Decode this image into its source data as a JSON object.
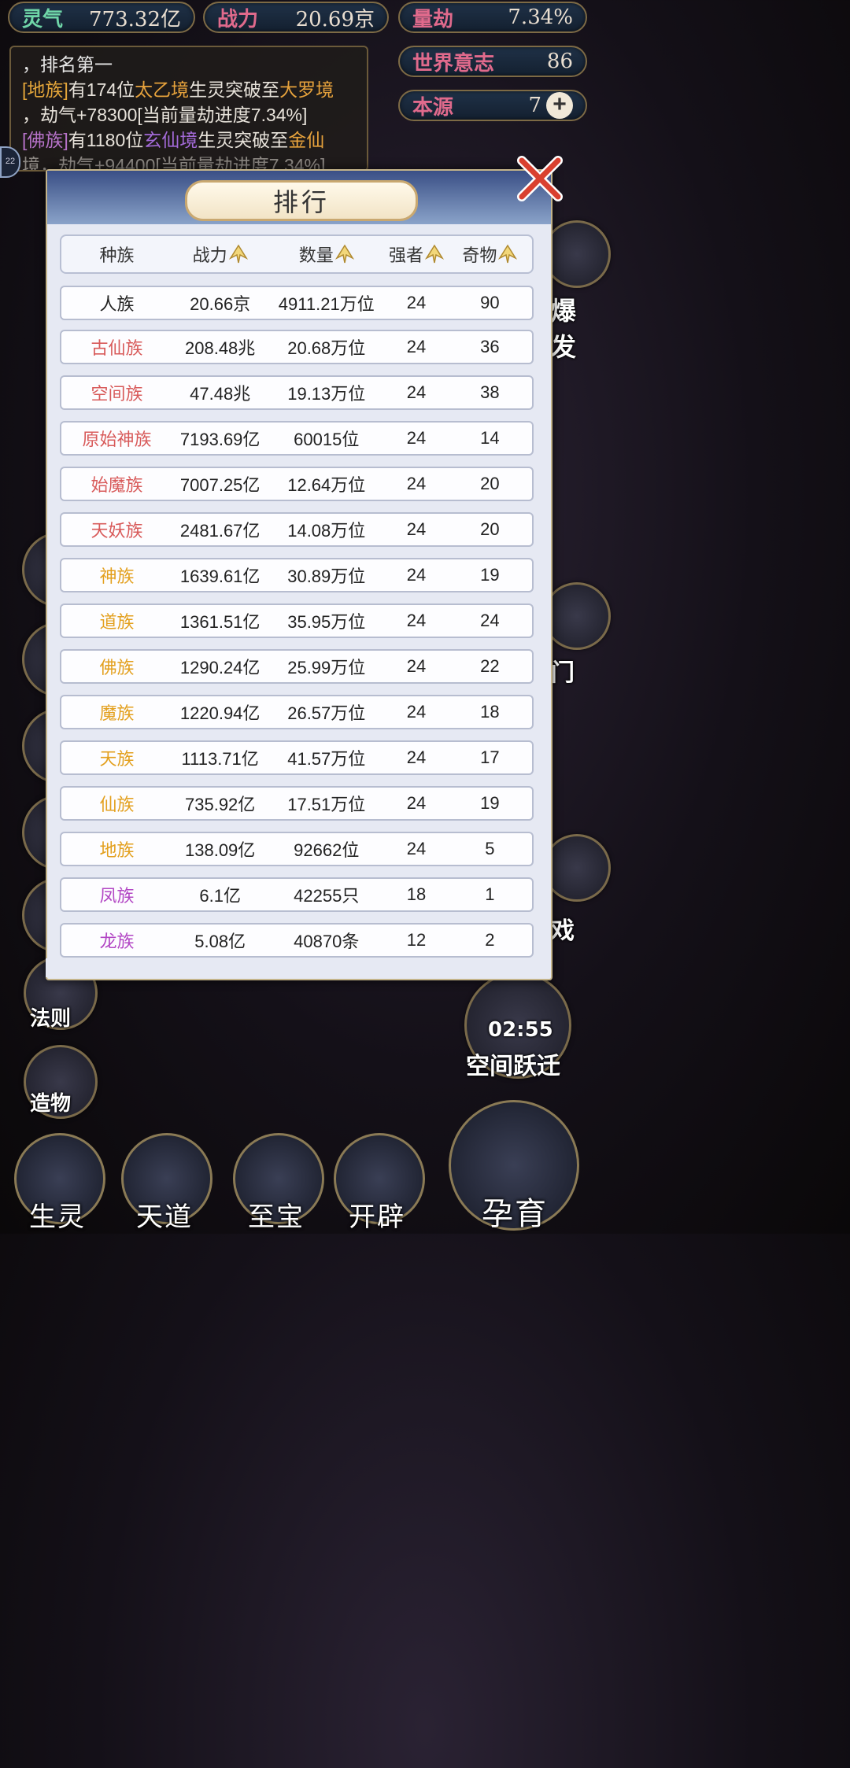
{
  "stats": {
    "lingqi": {
      "label": "灵气",
      "value": "773.32亿"
    },
    "zhanli": {
      "label": "战力",
      "value": "20.69京"
    },
    "liangjie": {
      "label": "量劫",
      "value": "7.34%"
    },
    "world_will": {
      "label": "世界意志",
      "value": "86"
    },
    "benyuan": {
      "label": "本源",
      "value": "7",
      "plus": "+"
    }
  },
  "log": {
    "line1": "，排名第一",
    "line2_a": "[地族]",
    "line2_b": "有174位",
    "line2_c": "太乙境",
    "line2_d": "生灵突破至",
    "line2_e": "大罗境",
    "line3": "，劫气+78300[当前量劫进度7.34%]",
    "line4_a": "[佛族]",
    "line4_b": "有1180位",
    "line4_c": "玄仙境",
    "line4_d": "生灵突破至",
    "line4_e": "金仙",
    "line5": "境，劫气+94400[当前量劫进度7.34%]",
    "side_badge": "22"
  },
  "modal": {
    "title": "排行",
    "headers": [
      "种族",
      "战力",
      "数量",
      "强者",
      "奇物"
    ],
    "rows": [
      {
        "race": "人族",
        "power": "20.66京",
        "count": "4911.21万位",
        "elite": "24",
        "treasure": "90",
        "color": "black"
      },
      {
        "race": "古仙族",
        "power": "208.48兆",
        "count": "20.68万位",
        "elite": "24",
        "treasure": "36",
        "color": "red"
      },
      {
        "race": "空间族",
        "power": "47.48兆",
        "count": "19.13万位",
        "elite": "24",
        "treasure": "38",
        "color": "red"
      },
      {
        "race": "原始神族",
        "power": "7193.69亿",
        "count": "60015位",
        "elite": "24",
        "treasure": "14",
        "color": "red"
      },
      {
        "race": "始魔族",
        "power": "7007.25亿",
        "count": "12.64万位",
        "elite": "24",
        "treasure": "20",
        "color": "red"
      },
      {
        "race": "天妖族",
        "power": "2481.67亿",
        "count": "14.08万位",
        "elite": "24",
        "treasure": "20",
        "color": "red"
      },
      {
        "race": "神族",
        "power": "1639.61亿",
        "count": "30.89万位",
        "elite": "24",
        "treasure": "19",
        "color": "orange"
      },
      {
        "race": "道族",
        "power": "1361.51亿",
        "count": "35.95万位",
        "elite": "24",
        "treasure": "24",
        "color": "orange"
      },
      {
        "race": "佛族",
        "power": "1290.24亿",
        "count": "25.99万位",
        "elite": "24",
        "treasure": "22",
        "color": "orange"
      },
      {
        "race": "魔族",
        "power": "1220.94亿",
        "count": "26.57万位",
        "elite": "24",
        "treasure": "18",
        "color": "orange"
      },
      {
        "race": "天族",
        "power": "1113.71亿",
        "count": "41.57万位",
        "elite": "24",
        "treasure": "17",
        "color": "orange"
      },
      {
        "race": "仙族",
        "power": "735.92亿",
        "count": "17.51万位",
        "elite": "24",
        "treasure": "19",
        "color": "orange"
      },
      {
        "race": "地族",
        "power": "138.09亿",
        "count": "92662位",
        "elite": "24",
        "treasure": "5",
        "color": "orange"
      },
      {
        "race": "凤族",
        "power": "6.1亿",
        "count": "42255只",
        "elite": "18",
        "treasure": "1",
        "color": "violet"
      },
      {
        "race": "龙族",
        "power": "5.08亿",
        "count": "40870条",
        "elite": "12",
        "treasure": "2",
        "color": "violet"
      }
    ]
  },
  "side": {
    "fazhe": "法则",
    "zaowu": "造物",
    "right_top": "爆发",
    "right_mid": "门",
    "right_low": "戏",
    "timer": "02:55",
    "space_jump": "空间跃迁"
  },
  "bottom": {
    "shengling": "生灵",
    "tiandao": "天道",
    "zhibao": "至宝",
    "kaipi": "开辟",
    "yunyu": "孕育"
  },
  "colors": {
    "red": "#d85a5a",
    "orange": "#e3a01e",
    "violet": "#b246c4",
    "gold_border": "#c9a870"
  }
}
